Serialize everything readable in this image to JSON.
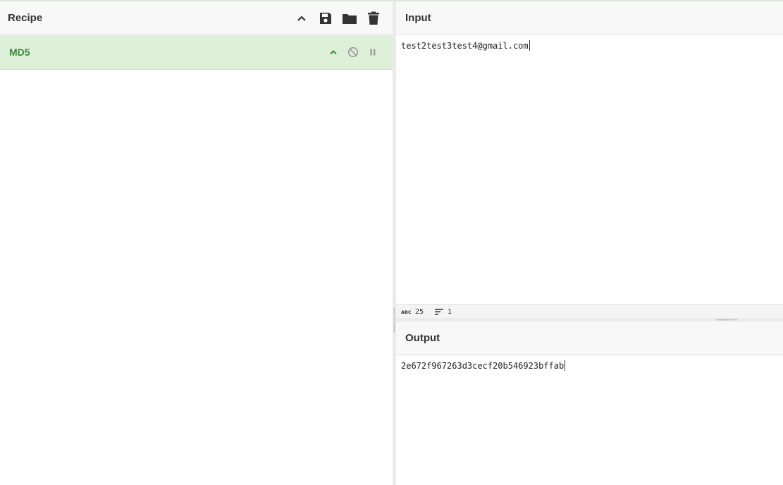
{
  "recipe": {
    "title": "Recipe",
    "header_icons": [
      "chevron-up-icon",
      "save-icon",
      "folder-icon",
      "trash-icon"
    ],
    "operations": [
      {
        "name": "MD5",
        "icons": [
          "chevron-up-icon",
          "disable-icon",
          "pause-icon"
        ]
      }
    ]
  },
  "input": {
    "title": "Input",
    "value": "test2test3test4@gmail.com"
  },
  "status": {
    "length_icon": "abc-icon",
    "length": "25",
    "lines_icon": "lines-icon",
    "lines": "1"
  },
  "output": {
    "title": "Output",
    "value": "2e672f967263d3cecf20b546923bffab"
  },
  "colors": {
    "operation_bg": "#dff0d8",
    "operation_text": "#3c8a3c",
    "icon_dark": "#333333",
    "icon_muted": "#9a9a9a"
  }
}
